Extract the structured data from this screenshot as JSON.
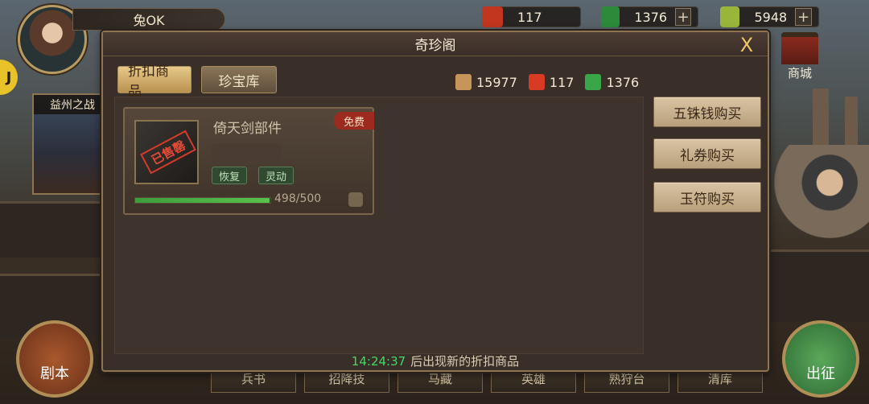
{
  "hud": {
    "player_name": "兔OK",
    "left_badge": "J",
    "yizhou_label": "益州之战",
    "top_resources": [
      {
        "icon": "ticket-icon",
        "value": "117",
        "color": "#c2361f"
      },
      {
        "icon": "jade-icon",
        "value": "1376",
        "color": "#2c8a3a"
      },
      {
        "icon": "coin-scroll-icon",
        "value": "5948",
        "color": "#9ab63a"
      }
    ],
    "shop_label": "商城",
    "juben_label": "剧本",
    "chuzheng_label": "出征",
    "bottom_tabs": [
      "兵书",
      "招降技",
      "马藏",
      "英雄",
      "熟狩台",
      "清库"
    ]
  },
  "dialog": {
    "title": "奇珍阁",
    "close": "X",
    "tabs": [
      {
        "label": "折扣商品",
        "active": true
      },
      {
        "label": "珍宝库",
        "active": false
      }
    ],
    "currencies": [
      {
        "icon": "wuzhu-coin-icon",
        "value": "15977",
        "color": "#c6955a"
      },
      {
        "icon": "gift-voucher-icon",
        "value": "117",
        "color": "#d83a24"
      },
      {
        "icon": "jade-token-icon",
        "value": "1376",
        "color": "#3aa64a"
      }
    ],
    "item": {
      "name": "倚天剑部件",
      "tag": "免费",
      "stamp": "已售罄",
      "attrs": [
        "恢复",
        "灵动"
      ],
      "progress_text": "498/500",
      "progress_fraction": 0.996
    },
    "buy_buttons": [
      "五铢钱购买",
      "礼券购买",
      "玉符购买"
    ],
    "footer_timer": "14:24:37",
    "footer_text": "后出现新的折扣商品"
  }
}
